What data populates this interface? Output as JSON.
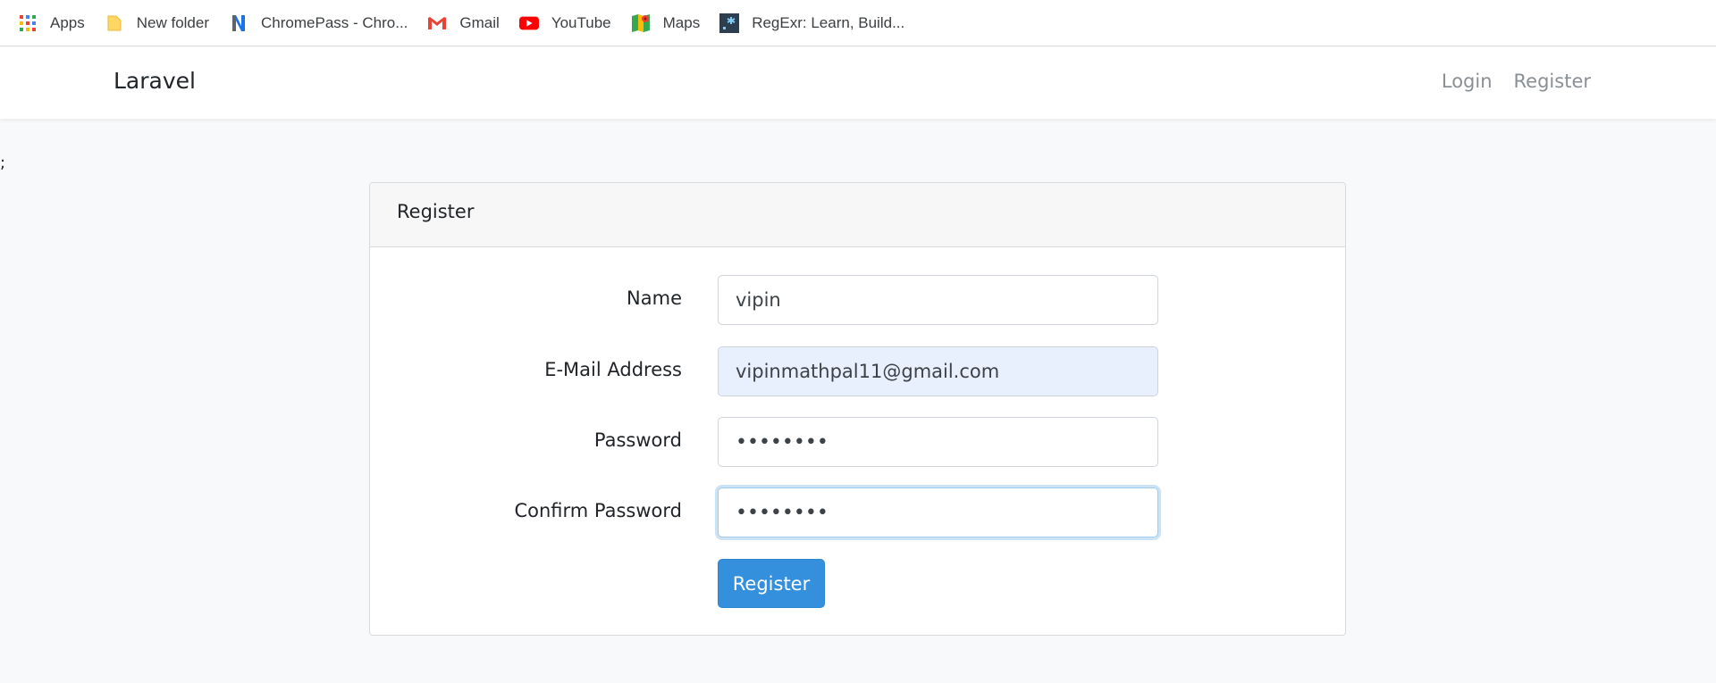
{
  "bookmarks": [
    {
      "label": "Apps",
      "icon": "apps-grid-icon"
    },
    {
      "label": "New folder",
      "icon": "folder-icon"
    },
    {
      "label": "ChromePass - Chro...",
      "icon": "chromepass-icon"
    },
    {
      "label": "Gmail",
      "icon": "gmail-icon"
    },
    {
      "label": "YouTube",
      "icon": "youtube-icon"
    },
    {
      "label": "Maps",
      "icon": "maps-icon"
    },
    {
      "label": "RegExr: Learn, Build...",
      "icon": "regexr-icon"
    }
  ],
  "navbar": {
    "brand": "Laravel",
    "links": {
      "login": "Login",
      "register": "Register"
    }
  },
  "stray_text": ";",
  "card": {
    "title": "Register",
    "fields": {
      "name": {
        "label": "Name",
        "value": "vipin"
      },
      "email": {
        "label": "E-Mail Address",
        "value": "vipinmathpal11@gmail.com"
      },
      "password": {
        "label": "Password",
        "value": "••••••••"
      },
      "confirm": {
        "label": "Confirm Password",
        "value": "••••••••"
      }
    },
    "submit_label": "Register"
  },
  "colors": {
    "primary": "#3490dc",
    "autofill_bg": "#e8f0fe",
    "page_bg": "#f8f9fb"
  }
}
